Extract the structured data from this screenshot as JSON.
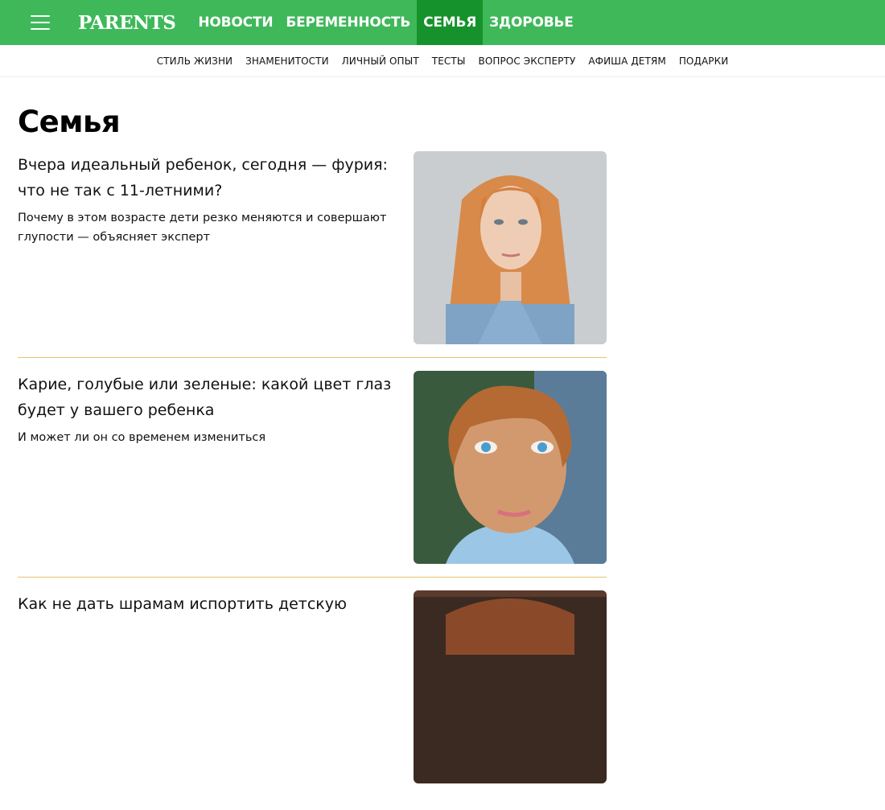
{
  "header": {
    "logo": "PARENTS",
    "nav": [
      {
        "label": "НОВОСТИ",
        "active": false
      },
      {
        "label": "БЕРЕМЕННОСТЬ",
        "active": false
      },
      {
        "label": "СЕМЬЯ",
        "active": true
      },
      {
        "label": "ЗДОРОВЬЕ",
        "active": false
      }
    ]
  },
  "subnav": [
    "СТИЛЬ ЖИЗНИ",
    "ЗНАМЕНИТОСТИ",
    "ЛИЧНЫЙ ОПЫТ",
    "ТЕСТЫ",
    "ВОПРОС ЭКСПЕРТУ",
    "АФИША ДЕТЯМ",
    "ПОДАРКИ"
  ],
  "page": {
    "title": "Семья"
  },
  "articles": [
    {
      "headline": "Вчера идеальный ребенок, сегодня — фурия: что не так с 11-летними?",
      "lead": "Почему в этом возрасте дети резко меняются и совершают глупости — объясняет эксперт"
    },
    {
      "headline": "Карие, голубые или зеленые: какой цвет глаз будет у вашего ребенка",
      "lead": "И может ли он со временем измениться"
    },
    {
      "headline": "Как не дать шрамам испортить детскую",
      "lead": ""
    }
  ],
  "colors": {
    "brand_green": "#3fb85a",
    "active_green": "#15922b",
    "divider": "#e5c46e"
  }
}
